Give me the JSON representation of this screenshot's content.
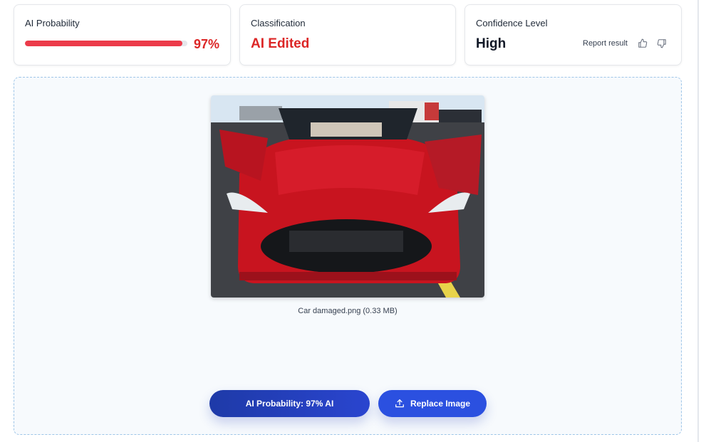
{
  "cards": {
    "probability": {
      "label": "AI Probability",
      "value": "97%",
      "fraction": 0.97,
      "bar_color": "#ec3b4a"
    },
    "classification": {
      "label": "Classification",
      "value": "AI Edited",
      "color": "#dc2626"
    },
    "confidence": {
      "label": "Confidence Level",
      "value": "High",
      "report_label": "Report result",
      "icons": [
        "thumbs-up-icon",
        "thumbs-down-icon"
      ]
    }
  },
  "upload": {
    "filename": "Car damaged.png (0.33 MB)",
    "ai_button_label": "AI Probability: 97% AI",
    "replace_button_label": "Replace Image",
    "replace_icon": "upload-icon"
  }
}
